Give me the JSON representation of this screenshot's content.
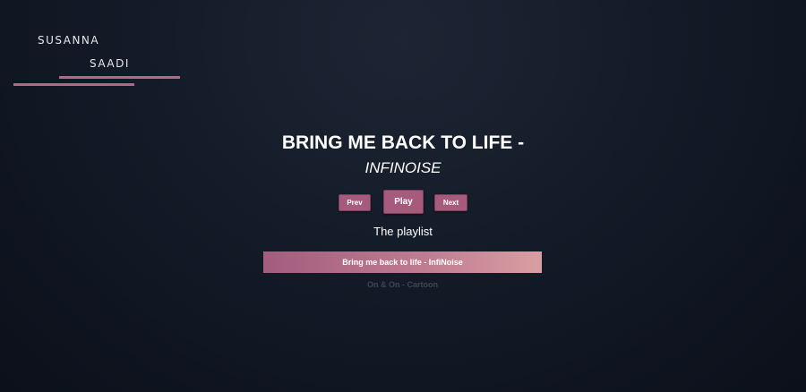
{
  "logo": {
    "first_name": "Susanna",
    "last_name": "Saadi"
  },
  "player": {
    "title": "BRING ME BACK TO LIFE -",
    "artist": "INFINOISE",
    "controls": {
      "prev_label": "Prev",
      "play_label": "Play",
      "next_label": "Next"
    }
  },
  "playlist": {
    "heading": "The playlist",
    "items": [
      {
        "label": "Bring me back to life - InfiNoise",
        "active": true
      },
      {
        "label": "On & On - Cartoon",
        "active": false
      }
    ]
  },
  "colors": {
    "accent": "#a65a7c",
    "background": "#141b28",
    "inactive_text": "#3e4656"
  }
}
